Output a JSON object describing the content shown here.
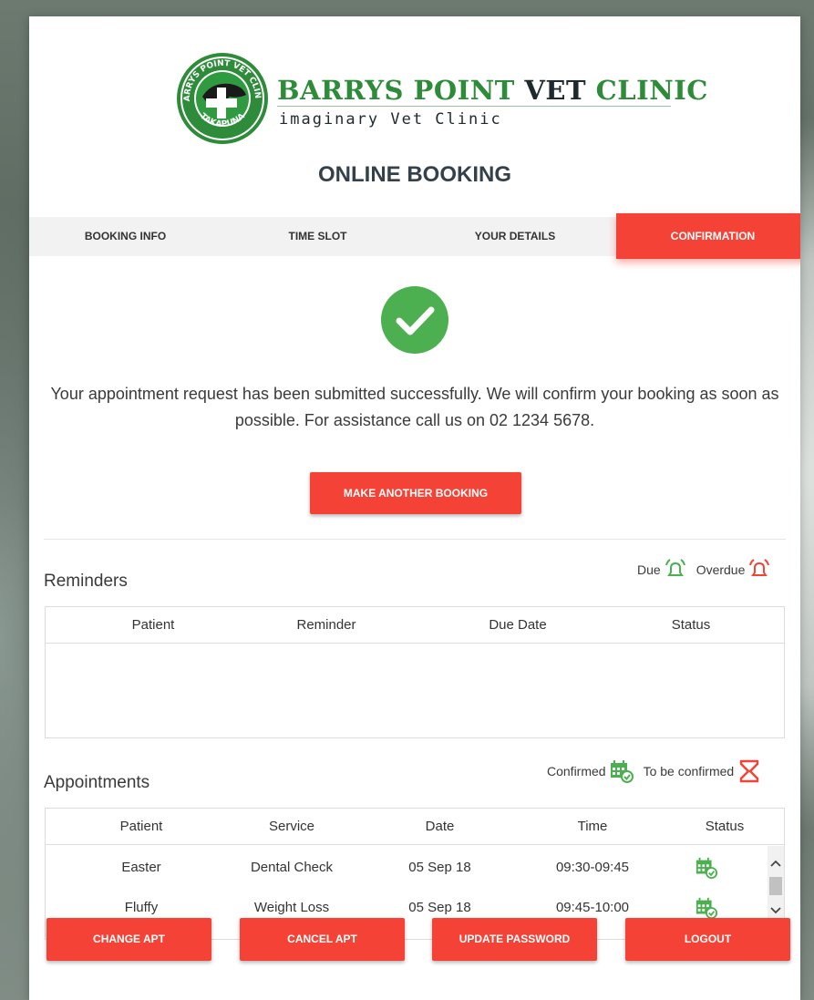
{
  "clinic": {
    "name_part1": "BARRYS POINT ",
    "name_part2": "VET",
    "name_part3": " CLINIC",
    "subtitle": "imaginary Vet Clinic",
    "seal_top": "BARRYS POINT VET CLINIC",
    "seal_bottom": "TAKAPUNA"
  },
  "page_title": "ONLINE BOOKING",
  "steps": [
    {
      "label": "BOOKING INFO",
      "active": false
    },
    {
      "label": "TIME SLOT",
      "active": false
    },
    {
      "label": "YOUR DETAILS",
      "active": false
    },
    {
      "label": "CONFIRMATION",
      "active": true
    }
  ],
  "confirmation_message": "Your appointment request has been submitted successfully. We will confirm your booking as soon as possible. For assistance call us on 02 1234 5678.",
  "make_another_label": "MAKE ANOTHER BOOKING",
  "reminders": {
    "title": "Reminders",
    "legend_due": "Due",
    "legend_overdue": "Overdue",
    "columns": [
      "Patient",
      "Reminder",
      "Due Date",
      "Status"
    ],
    "rows": []
  },
  "appointments": {
    "title": "Appointments",
    "legend_confirmed": "Confirmed",
    "legend_pending": "To be confirmed",
    "columns": [
      "Patient",
      "Service",
      "Date",
      "Time",
      "Status"
    ],
    "rows": [
      {
        "patient": "Easter",
        "service": "Dental Check",
        "date": "05 Sep 18",
        "time": "09:30-09:45",
        "status": "confirmed"
      },
      {
        "patient": "Fluffy",
        "service": "Weight Loss",
        "date": "05 Sep 18",
        "time": "09:45-10:00",
        "status": "confirmed"
      }
    ]
  },
  "actions": {
    "change_label": "CHANGE APT",
    "cancel_label": "CANCEL APT",
    "update_password_label": "UPDATE PASSWORD",
    "logout_label": "LOGOUT"
  },
  "colors": {
    "accent": "#f44336",
    "success": "#4caf50",
    "brand_green": "#2e8b3a"
  },
  "icons": {
    "confirmed": "calendar-check-icon",
    "pending": "hourglass-icon",
    "due": "bell-green-icon",
    "overdue": "bell-red-icon",
    "success": "check-circle-icon"
  }
}
